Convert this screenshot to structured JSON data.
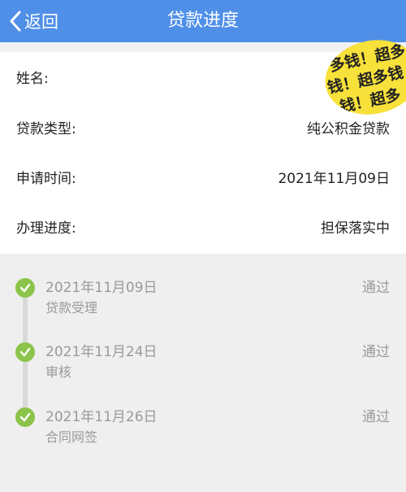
{
  "navbar": {
    "back_label": "返回",
    "title": "贷款进度",
    "background": "#4f8fe8"
  },
  "info": {
    "rows": [
      {
        "label": "姓名:",
        "value": ""
      },
      {
        "label": "贷款类型:",
        "value": "纯公积金贷款"
      },
      {
        "label": "申请时间:",
        "value": "2021年11月09日"
      },
      {
        "label": "办理进度:",
        "value": "担保落实中"
      }
    ]
  },
  "sticker": {
    "lines": [
      "多钱！超多",
      "钱！超多钱",
      "钱！超多"
    ],
    "color": "#f7e13a"
  },
  "timeline": {
    "check_color": "#8cc34a",
    "items": [
      {
        "date": "2021年11月09日",
        "step": "贷款受理",
        "status": "通过"
      },
      {
        "date": "2021年11月24日",
        "step": "审核",
        "status": "通过"
      },
      {
        "date": "2021年11月26日",
        "step": "合同网签",
        "status": "通过"
      }
    ]
  }
}
